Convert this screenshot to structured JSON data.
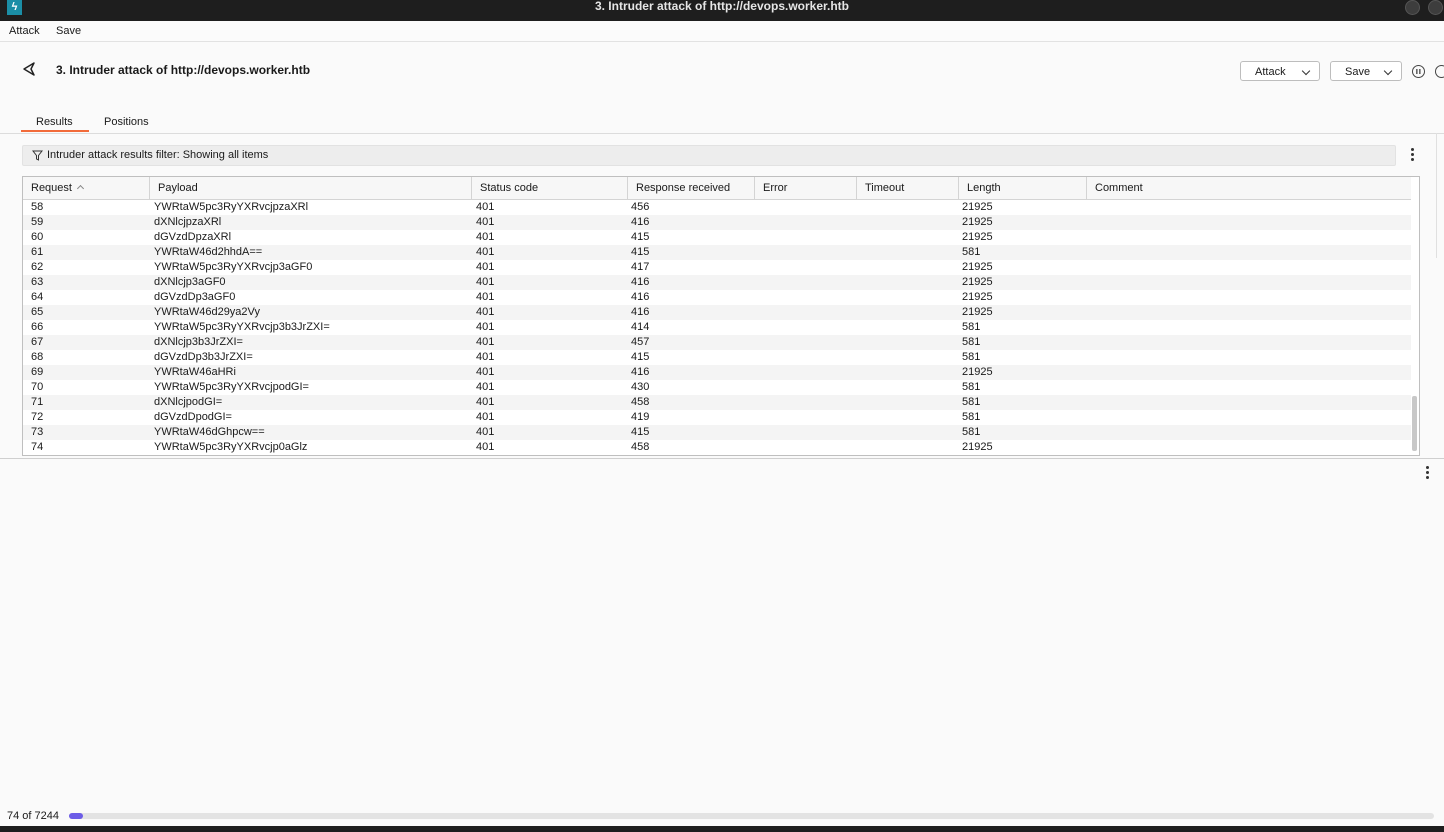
{
  "window": {
    "title": "3. Intruder attack of http://devops.worker.htb",
    "app_icon": "burp-lightning-icon"
  },
  "menubar": {
    "attack": "Attack",
    "save": "Save"
  },
  "header": {
    "title": "3. Intruder attack of http://devops.worker.htb",
    "attack_button": "Attack",
    "save_button": "Save"
  },
  "tabs": [
    {
      "label": "Results",
      "active": true
    },
    {
      "label": "Positions",
      "active": false
    }
  ],
  "filter": {
    "text": "Intruder attack results filter: Showing all items"
  },
  "table": {
    "columns": [
      "Request",
      "Payload",
      "Status code",
      "Response received",
      "Error",
      "Timeout",
      "Length",
      "Comment"
    ],
    "sort_column": "Request",
    "rows": [
      [
        "58",
        "YWRtaW5pc3RyYXRvcjpzaXRl",
        "401",
        "456",
        "",
        "",
        "21925",
        ""
      ],
      [
        "59",
        "dXNlcjpzaXRl",
        "401",
        "416",
        "",
        "",
        "21925",
        ""
      ],
      [
        "60",
        "dGVzdDpzaXRl",
        "401",
        "415",
        "",
        "",
        "21925",
        ""
      ],
      [
        "61",
        "YWRtaW46d2hhdA==",
        "401",
        "415",
        "",
        "",
        "581",
        ""
      ],
      [
        "62",
        "YWRtaW5pc3RyYXRvcjp3aGF0",
        "401",
        "417",
        "",
        "",
        "21925",
        ""
      ],
      [
        "63",
        "dXNlcjp3aGF0",
        "401",
        "416",
        "",
        "",
        "21925",
        ""
      ],
      [
        "64",
        "dGVzdDp3aGF0",
        "401",
        "416",
        "",
        "",
        "21925",
        ""
      ],
      [
        "65",
        "YWRtaW46d29ya2Vy",
        "401",
        "416",
        "",
        "",
        "21925",
        ""
      ],
      [
        "66",
        "YWRtaW5pc3RyYXRvcjp3b3JrZXI=",
        "401",
        "414",
        "",
        "",
        "581",
        ""
      ],
      [
        "67",
        "dXNlcjp3b3JrZXI=",
        "401",
        "457",
        "",
        "",
        "581",
        ""
      ],
      [
        "68",
        "dGVzdDp3b3JrZXI=",
        "401",
        "415",
        "",
        "",
        "581",
        ""
      ],
      [
        "69",
        "YWRtaW46aHRi",
        "401",
        "416",
        "",
        "",
        "21925",
        ""
      ],
      [
        "70",
        "YWRtaW5pc3RyYXRvcjpodGI=",
        "401",
        "430",
        "",
        "",
        "581",
        ""
      ],
      [
        "71",
        "dXNlcjpodGI=",
        "401",
        "458",
        "",
        "",
        "581",
        ""
      ],
      [
        "72",
        "dGVzdDpodGI=",
        "401",
        "419",
        "",
        "",
        "581",
        ""
      ],
      [
        "73",
        "YWRtaW46dGhpcw==",
        "401",
        "415",
        "",
        "",
        "581",
        ""
      ],
      [
        "74",
        "YWRtaW5pc3RyYXRvcjp0aGlz",
        "401",
        "458",
        "",
        "",
        "21925",
        ""
      ]
    ]
  },
  "progress": {
    "label": "74 of 7244",
    "done": 74,
    "total": 7244,
    "fill_color": "#6c5ce7"
  },
  "colors": {
    "accent_tab": "#f26b3a",
    "titlebar": "#1e1e1e"
  }
}
